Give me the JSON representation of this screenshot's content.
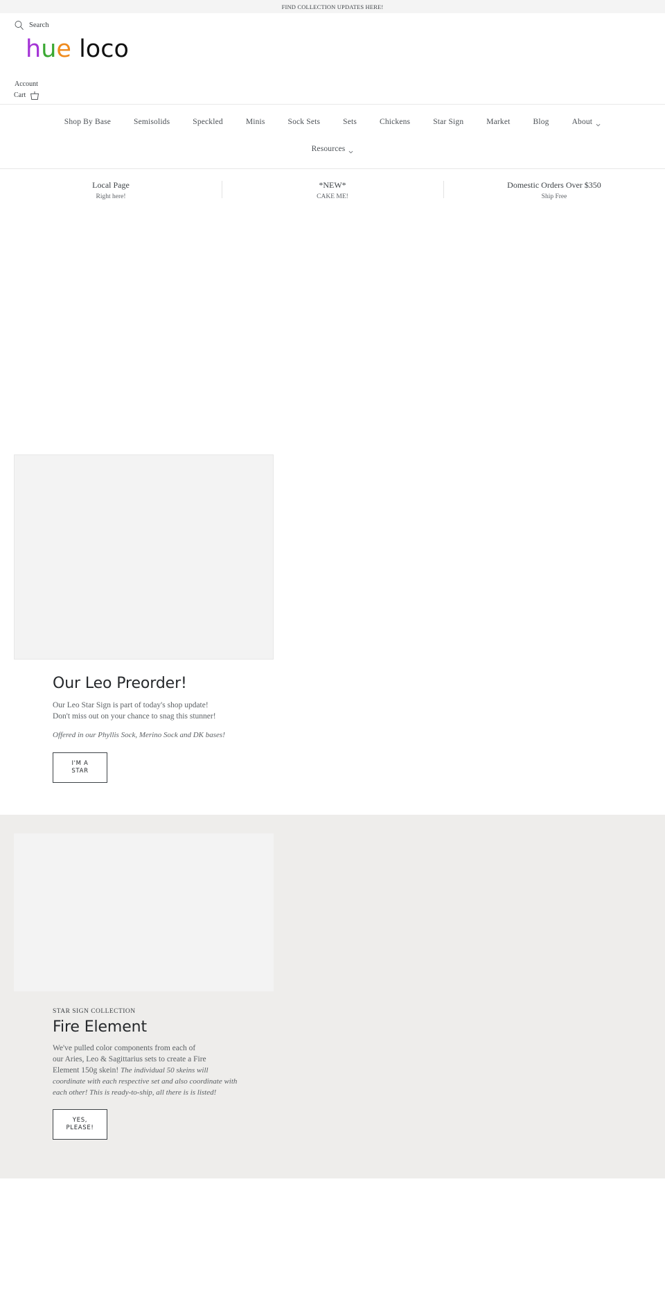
{
  "announcement": {
    "text": "FIND COLLECTION UPDATES HERE!"
  },
  "utility": {
    "search_label": "Search",
    "search_icon": "search-icon",
    "account_label": "Account",
    "cart_label": "Cart",
    "cart_icon": "shopping-cart-icon"
  },
  "logo": {
    "part_h": "h",
    "part_u": "u",
    "part_e": "e",
    "part_loco": "loco",
    "color_h": "#a433d6",
    "color_u": "#3aa832",
    "color_e": "#ef8b1e",
    "color_loco": "#111111"
  },
  "nav": {
    "primary": [
      {
        "label": "Shop By Base",
        "has_caret": false
      },
      {
        "label": "Semisolids",
        "has_caret": false
      },
      {
        "label": "Speckled",
        "has_caret": false
      },
      {
        "label": "Minis",
        "has_caret": false
      },
      {
        "label": "Sock Sets",
        "has_caret": false
      },
      {
        "label": "Sets",
        "has_caret": false
      },
      {
        "label": "Chickens",
        "has_caret": false
      },
      {
        "label": "Star Sign",
        "has_caret": false
      },
      {
        "label": "Market",
        "has_caret": false
      },
      {
        "label": "Blog",
        "has_caret": false
      },
      {
        "label": "About",
        "has_caret": true
      }
    ],
    "secondary": [
      {
        "label": "Resources",
        "has_caret": true
      }
    ]
  },
  "promo": [
    {
      "title": "Local Page",
      "sub": "Right here!"
    },
    {
      "title": "*NEW*",
      "sub": "CAKE ME!"
    },
    {
      "title": "Domestic Orders Over $350",
      "sub": "Ship Free"
    }
  ],
  "features": [
    {
      "eyebrow": "",
      "heading": "Our Leo Preorder!",
      "body_line1": "Our Leo Star Sign is part of today's shop update!",
      "body_line2": "Don't miss out on your chance to snag this stunner!",
      "italic": "Offered in our Phyllis Sock, Merino Sock and DK bases!",
      "button": "I'M A\nSTAR"
    },
    {
      "eyebrow": "STAR SIGN COLLECTION",
      "heading": "Fire Element",
      "body_line1": "We've pulled color components from each of",
      "body_line2": "our Aries, Leo & Sagittarius sets to create a Fire",
      "body_line3": "Element 150g skein!",
      "italic": "The individual 50 skeins will coordinate with each respective set and also coordinate with each other! This is ready-to-ship, all there is is listed!",
      "button": "YES,\nPLEASE!"
    }
  ]
}
